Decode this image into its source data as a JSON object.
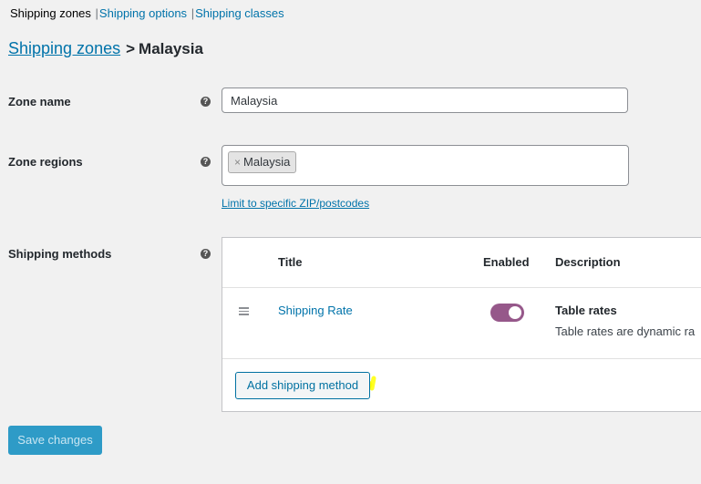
{
  "subnav": {
    "current": "Shipping zones",
    "items": [
      "Shipping options",
      "Shipping classes"
    ],
    "separator": "|"
  },
  "breadcrumb": {
    "link": "Shipping zones",
    "separator": ">",
    "zone": "Malaysia"
  },
  "zone_name": {
    "label": "Zone name",
    "value": "Malaysia",
    "help_icon": "help-question-icon"
  },
  "zone_regions": {
    "label": "Zone regions",
    "selected": [
      "Malaysia"
    ],
    "remove_glyph": "×",
    "limit_link": "Limit to specific ZIP/postcodes"
  },
  "shipping_methods": {
    "label": "Shipping methods",
    "columns": {
      "title": "Title",
      "enabled": "Enabled",
      "description": "Description"
    },
    "rows": [
      {
        "title": "Shipping Rate",
        "enabled": true,
        "desc_title": "Table rates",
        "desc_text": "Table rates are dynamic ra"
      }
    ],
    "add_button": "Add shipping method"
  },
  "save_button": "Save changes",
  "colors": {
    "link": "#0073aa",
    "toggle_on": "#96588a",
    "primary_button": "#2e9bc7",
    "highlight": "#ffff00"
  }
}
